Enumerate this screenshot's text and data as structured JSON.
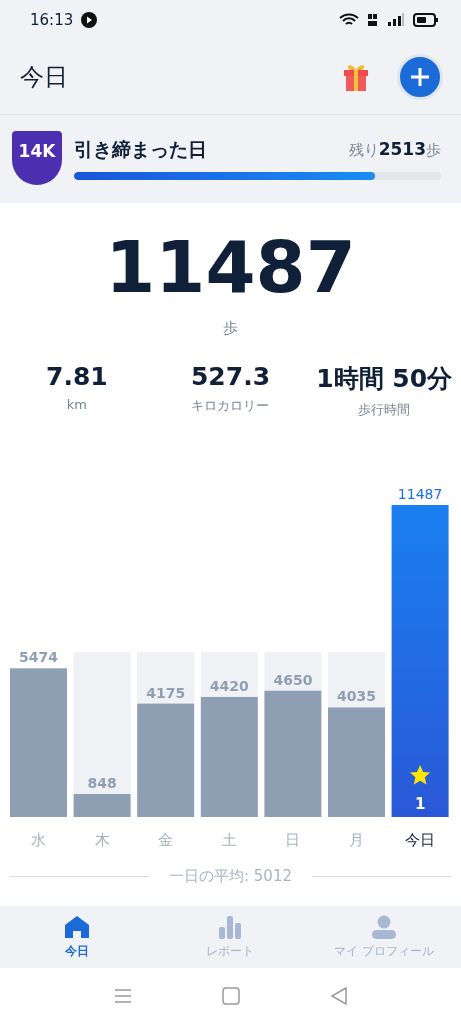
{
  "status_bar": {
    "time": "16:13"
  },
  "header": {
    "title": "今日"
  },
  "goal": {
    "badge": "14K",
    "title": "引き締まった日",
    "remaining": "残り**2513**歩",
    "level": 0.82
  },
  "today": {
    "steps": "11487",
    "unit": "歩"
  },
  "stats": [
    {
      "value": "7.81",
      "label": "km"
    },
    {
      "value": "527.3",
      "label": "キロカロリー"
    },
    {
      "value": "1時間 50分",
      "label": "歩行時間"
    }
  ],
  "chart": {
    "chart_data": {
      "type": "bar",
      "categories": [
        "水",
        "木",
        "金",
        "土",
        "日",
        "月",
        "今日"
      ],
      "data_labels": true,
      "ylim": [
        0,
        11487
      ],
      "values": [
        5474,
        848,
        4175,
        4420,
        4650,
        4035,
        11487
      ]
    },
    "days": [
      {
        "selected": false
      },
      {
        "selected": false
      },
      {
        "selected": false
      },
      {
        "selected": false
      },
      {
        "selected": false
      },
      {
        "selected": false
      },
      {
        "selected": true
      }
    ],
    "star_count": "1",
    "average": "一日の平均: 5012"
  },
  "tabs": [
    {
      "label": "今日",
      "selected": true
    },
    {
      "label": "レポート",
      "selected": false
    },
    {
      "label": "マイ プロフィール",
      "selected": false
    }
  ]
}
